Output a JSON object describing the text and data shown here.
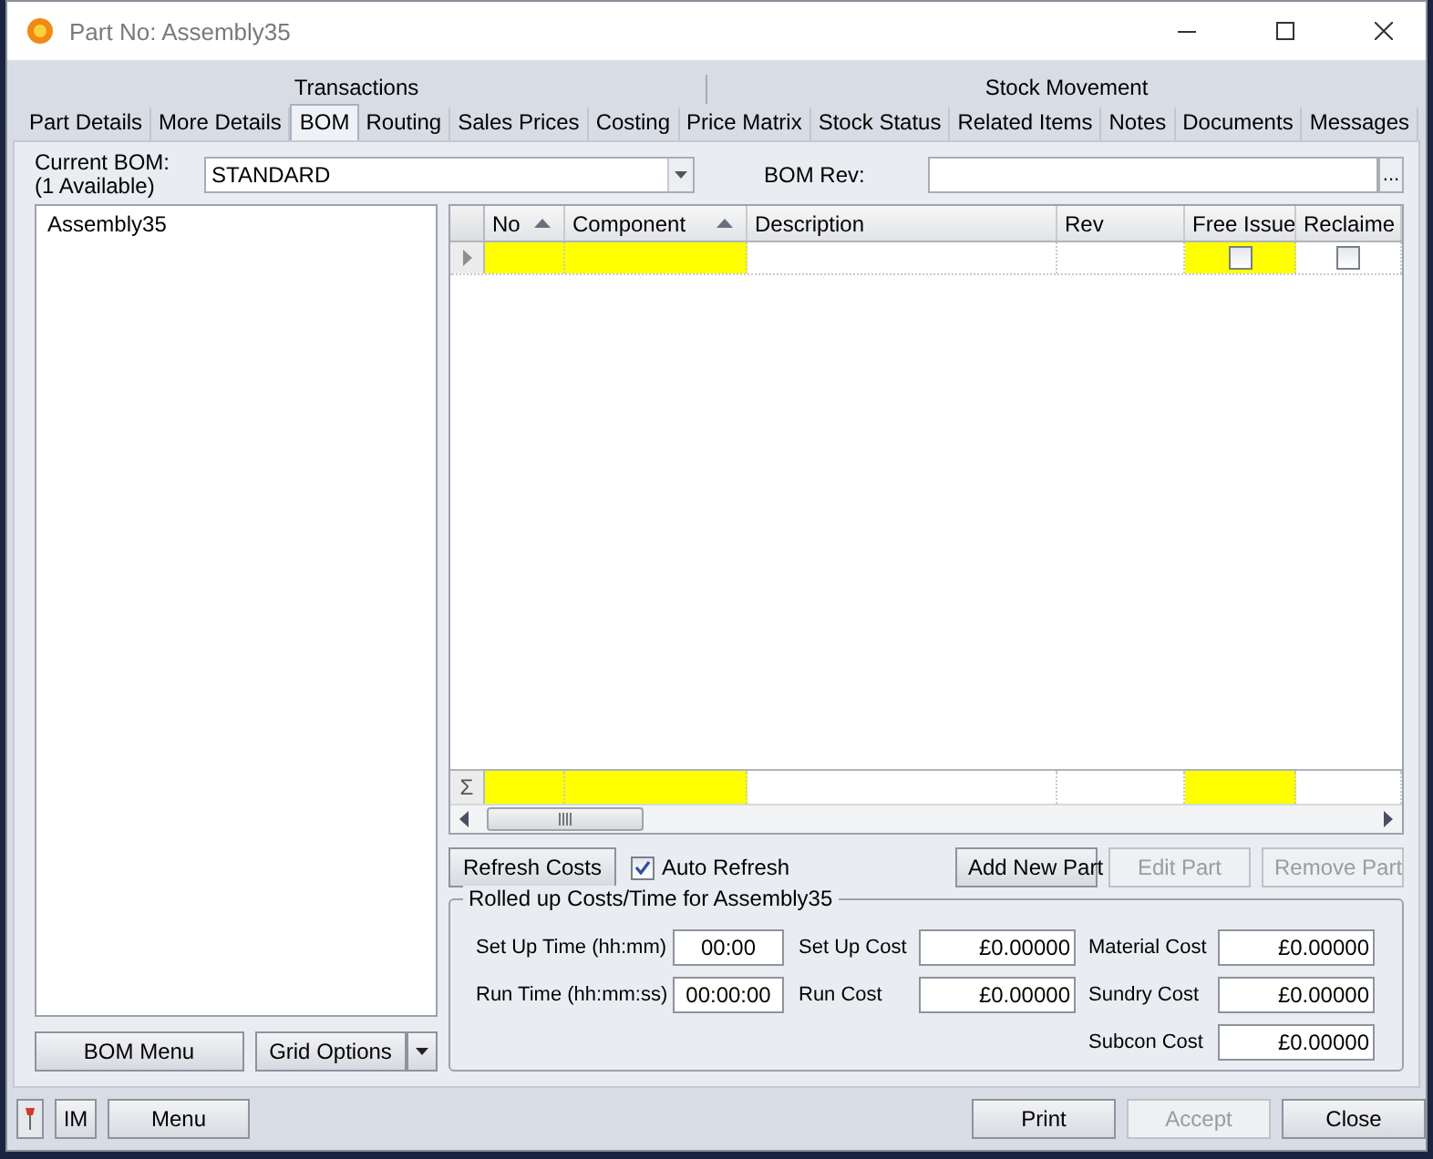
{
  "window": {
    "title": "Part No: Assembly35"
  },
  "tab_groups": [
    {
      "label": "Transactions"
    },
    {
      "label": "Stock Movement"
    }
  ],
  "tabs": [
    {
      "label": "Part Details",
      "selected": false
    },
    {
      "label": "More Details",
      "selected": false
    },
    {
      "label": "BOM",
      "selected": true
    },
    {
      "label": "Routing",
      "selected": false
    },
    {
      "label": "Sales Prices",
      "selected": false
    },
    {
      "label": "Costing",
      "selected": false
    },
    {
      "label": "Price Matrix",
      "selected": false
    },
    {
      "label": "Stock Status",
      "selected": false
    },
    {
      "label": "Related Items",
      "selected": false
    },
    {
      "label": "Notes",
      "selected": false
    },
    {
      "label": "Documents",
      "selected": false
    },
    {
      "label": "Messages",
      "selected": false
    }
  ],
  "current_bom": {
    "label_lines": [
      "Current BOM:",
      "(1 Available)"
    ],
    "value": "STANDARD"
  },
  "bom_rev": {
    "label": "BOM Rev:",
    "button": "..."
  },
  "tree": [
    {
      "label": "Assembly35"
    }
  ],
  "grid": {
    "columns": [
      {
        "label": "No",
        "sorted": true,
        "highlighted": true,
        "kind": "text"
      },
      {
        "label": "Component",
        "sorted": true,
        "highlighted": true,
        "kind": "text"
      },
      {
        "label": "Description",
        "sorted": false,
        "highlighted": false,
        "kind": "text"
      },
      {
        "label": "Rev",
        "sorted": false,
        "highlighted": false,
        "kind": "text"
      },
      {
        "label": "Free Issue",
        "sorted": false,
        "highlighted": true,
        "kind": "check"
      },
      {
        "label": "Reclaime",
        "sorted": false,
        "highlighted": false,
        "kind": "check"
      }
    ],
    "rows": [
      {
        "current": true,
        "cells": [
          {
            "checked": false
          },
          {
            "checked": false
          }
        ]
      }
    ],
    "summary_symbol": "Σ"
  },
  "grid_buttons": [
    {
      "label": "Refresh Costs",
      "disabled": false,
      "kind": "button"
    },
    {
      "label": "Auto Refresh",
      "checked": true,
      "kind": "checkbox"
    },
    {
      "label": "Add New Part",
      "disabled": false,
      "kind": "button"
    },
    {
      "label": "Edit Part",
      "disabled": true,
      "kind": "button"
    },
    {
      "label": "Remove Part",
      "disabled": true,
      "kind": "button"
    }
  ],
  "costs": {
    "legend": "Rolled up Costs/Time for Assembly35",
    "columns": [
      [
        {
          "label": "Set Up Time (hh:mm)",
          "value": "00:00",
          "kind": "time"
        },
        {
          "label": "Run Time (hh:mm:ss)",
          "value": "00:00:00",
          "kind": "time"
        }
      ],
      [
        {
          "label": "Set Up Cost",
          "value": "£0.00000",
          "kind": "money"
        },
        {
          "label": "Run Cost",
          "value": "£0.00000",
          "kind": "money"
        }
      ],
      [
        {
          "label": "Material Cost",
          "value": "£0.00000",
          "kind": "money"
        },
        {
          "label": "Sundry Cost",
          "value": "£0.00000",
          "kind": "money"
        },
        {
          "label": "Subcon Cost",
          "value": "£0.00000",
          "kind": "money"
        }
      ]
    ]
  },
  "left_buttons": [
    {
      "label": "BOM Menu",
      "dropdown": false
    },
    {
      "label": "Grid Options",
      "dropdown": true
    }
  ],
  "footer": {
    "left": [
      {
        "label": "IM"
      },
      {
        "label": "Menu"
      }
    ],
    "right": [
      {
        "label": "Print",
        "disabled": false
      },
      {
        "label": "Accept",
        "disabled": true
      },
      {
        "label": "Close",
        "disabled": false
      }
    ]
  }
}
